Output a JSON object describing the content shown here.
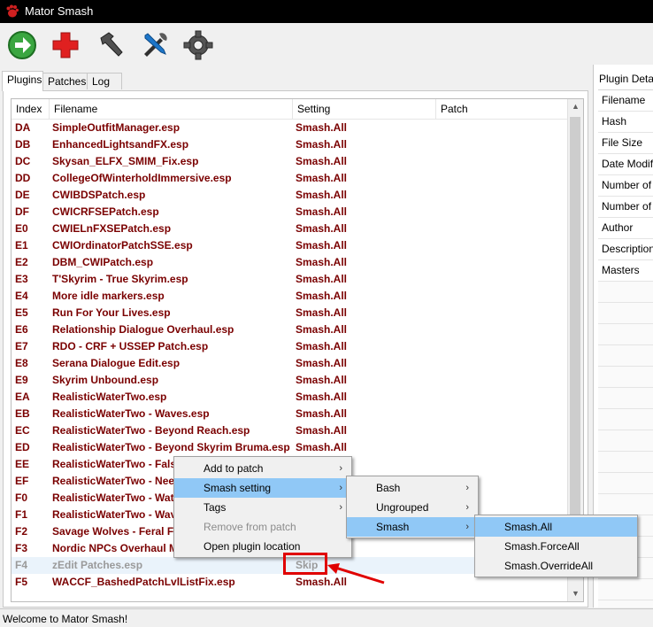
{
  "window": {
    "title": "Mator Smash"
  },
  "toolbar": {
    "icons": [
      "green-arrow-icon",
      "red-plus-icon",
      "hammer-icon",
      "tools-icon",
      "gear-icon"
    ]
  },
  "tabs": [
    {
      "label": "Plugins",
      "active": true
    },
    {
      "label": "Patches",
      "active": false
    },
    {
      "label": "Log",
      "active": false
    }
  ],
  "plugins": {
    "columns": [
      "Index",
      "Filename",
      "Setting",
      "Patch"
    ],
    "rows": [
      {
        "index": "DA",
        "filename": "SimpleOutfitManager.esp",
        "setting": "Smash.All"
      },
      {
        "index": "DB",
        "filename": "EnhancedLightsandFX.esp",
        "setting": "Smash.All"
      },
      {
        "index": "DC",
        "filename": "Skysan_ELFX_SMIM_Fix.esp",
        "setting": "Smash.All"
      },
      {
        "index": "DD",
        "filename": "CollegeOfWinterholdImmersive.esp",
        "setting": "Smash.All"
      },
      {
        "index": "DE",
        "filename": "CWIBDSPatch.esp",
        "setting": "Smash.All"
      },
      {
        "index": "DF",
        "filename": "CWICRFSEPatch.esp",
        "setting": "Smash.All"
      },
      {
        "index": "E0",
        "filename": "CWIELnFXSEPatch.esp",
        "setting": "Smash.All"
      },
      {
        "index": "E1",
        "filename": "CWIOrdinatorPatchSSE.esp",
        "setting": "Smash.All"
      },
      {
        "index": "E2",
        "filename": "DBM_CWIPatch.esp",
        "setting": "Smash.All"
      },
      {
        "index": "E3",
        "filename": "T'Skyrim - True Skyrim.esp",
        "setting": "Smash.All"
      },
      {
        "index": "E4",
        "filename": "More idle markers.esp",
        "setting": "Smash.All"
      },
      {
        "index": "E5",
        "filename": "Run For Your Lives.esp",
        "setting": "Smash.All"
      },
      {
        "index": "E6",
        "filename": "Relationship Dialogue Overhaul.esp",
        "setting": "Smash.All"
      },
      {
        "index": "E7",
        "filename": "RDO - CRF + USSEP Patch.esp",
        "setting": "Smash.All"
      },
      {
        "index": "E8",
        "filename": "Serana Dialogue Edit.esp",
        "setting": "Smash.All"
      },
      {
        "index": "E9",
        "filename": "Skyrim Unbound.esp",
        "setting": "Smash.All"
      },
      {
        "index": "EA",
        "filename": "RealisticWaterTwo.esp",
        "setting": "Smash.All"
      },
      {
        "index": "EB",
        "filename": "RealisticWaterTwo - Waves.esp",
        "setting": "Smash.All"
      },
      {
        "index": "EC",
        "filename": "RealisticWaterTwo - Beyond Reach.esp",
        "setting": "Smash.All"
      },
      {
        "index": "ED",
        "filename": "RealisticWaterTwo - Beyond Skyrim Bruma.esp",
        "setting": "Smash.All"
      },
      {
        "index": "EE",
        "filename": "RealisticWaterTwo - Fals",
        "setting": ""
      },
      {
        "index": "EF",
        "filename": "RealisticWaterTwo - Nee",
        "setting": ""
      },
      {
        "index": "F0",
        "filename": "RealisticWaterTwo - Wat",
        "setting": ""
      },
      {
        "index": "F1",
        "filename": "RealisticWaterTwo - Wav",
        "setting": ""
      },
      {
        "index": "F2",
        "filename": "Savage Wolves - Feral Fo",
        "setting": ""
      },
      {
        "index": "F3",
        "filename": "Nordic NPCs Overhaul Mix",
        "setting": ""
      },
      {
        "index": "F4",
        "filename": "zEdit Patches.esp",
        "setting": "Skip",
        "disabled": true
      },
      {
        "index": "F5",
        "filename": "WACCF_BashedPatchLvlListFix.esp",
        "setting": "Smash.All"
      }
    ]
  },
  "plugin_details": {
    "header": "Plugin Details",
    "fields": [
      "Filename",
      "Hash",
      "File Size",
      "Date Modifi",
      "Number of r",
      "Number of o",
      "Author",
      "Description",
      "Masters"
    ]
  },
  "context_menu": {
    "items": [
      {
        "label": "Add to patch",
        "submenu": true,
        "selected": false,
        "disabled": false
      },
      {
        "label": "Smash setting",
        "submenu": true,
        "selected": true,
        "disabled": false
      },
      {
        "label": "Tags",
        "submenu": true,
        "selected": false,
        "disabled": false
      },
      {
        "label": "Remove from patch",
        "submenu": false,
        "selected": false,
        "disabled": true
      },
      {
        "label": "Open plugin location",
        "submenu": false,
        "selected": false,
        "disabled": false
      }
    ]
  },
  "smash_setting_menu": {
    "items": [
      {
        "label": "Bash",
        "submenu": true,
        "selected": false
      },
      {
        "label": "Ungrouped",
        "submenu": true,
        "selected": false
      },
      {
        "label": "Smash",
        "submenu": true,
        "selected": true
      }
    ]
  },
  "smash_menu": {
    "items": [
      {
        "label": "Smash.All",
        "selected": true
      },
      {
        "label": "Smash.ForceAll",
        "selected": false
      },
      {
        "label": "Smash.OverrideAll",
        "selected": false
      }
    ]
  },
  "submenu_glyph": "›",
  "status": {
    "text": "Welcome to Mator Smash!"
  },
  "colors": {
    "plugin_text": "#7a0000",
    "disabled_text": "#9a9a9a",
    "menu_selected": "#90c8f6",
    "annotation": "#e00000"
  }
}
